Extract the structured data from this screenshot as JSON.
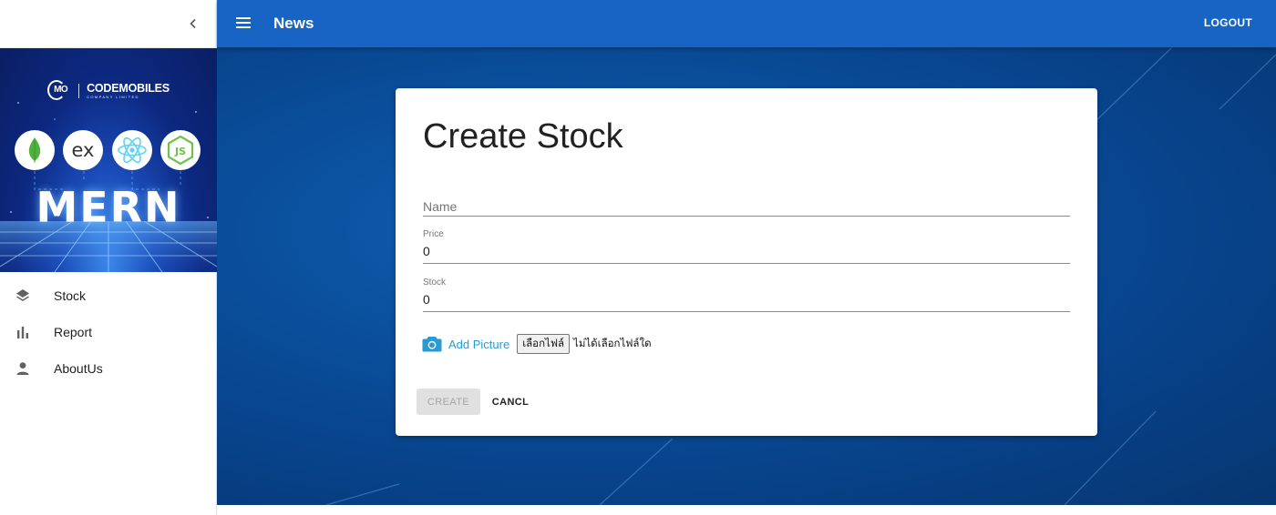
{
  "appbar": {
    "title": "News",
    "logout_label": "LOGOUT"
  },
  "sidebar": {
    "banner": {
      "brand_mark": "MO",
      "brand_name": "CODEMOBILES",
      "brand_sub": "COMPANY LIMITED",
      "tech_ex": "ex",
      "headline": "MERN"
    },
    "items": [
      {
        "label": "Stock",
        "icon": "layers-icon"
      },
      {
        "label": "Report",
        "icon": "bar-chart-icon"
      },
      {
        "label": "AboutUs",
        "icon": "person-icon"
      }
    ]
  },
  "form": {
    "title": "Create Stock",
    "name": {
      "placeholder": "Name",
      "value": ""
    },
    "price": {
      "label": "Price",
      "value": "0"
    },
    "stock": {
      "label": "Stock",
      "value": "0"
    },
    "add_picture_label": "Add Picture",
    "choose_file_label": "เลือกไฟล์",
    "no_file_label": "ไม่ได้เลือกไฟล์ใด",
    "create_label": "CREATE",
    "cancel_label": "CANCL"
  },
  "colors": {
    "appbar": "#1864c4",
    "accent": "#2a9bd2",
    "background": "#0a4f9c"
  }
}
